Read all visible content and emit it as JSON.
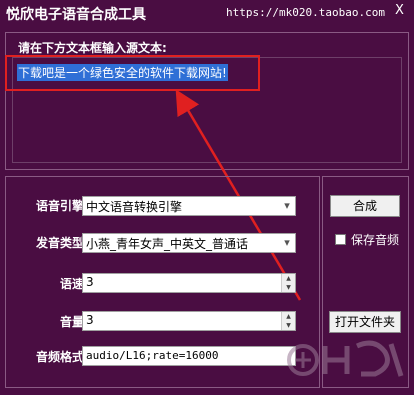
{
  "window": {
    "title": "悦欣电子语音合成工具",
    "url": "https://mk020.taobao.com",
    "close_label": "X"
  },
  "source": {
    "label": "请在下方文本框输入源文本:",
    "text": "下载吧是一个绿色安全的软件下载网站!"
  },
  "settings": {
    "engine_label": "语音引擎",
    "engine_value": "中文语音转换引擎",
    "voice_label": "发音类型",
    "voice_value": "小燕_青年女声_中英文_普通话",
    "rate_label": "语速",
    "rate_value": "3",
    "volume_label": "音量",
    "volume_value": "3",
    "format_label": "音频格式",
    "format_value": "audio/L16;rate=16000"
  },
  "actions": {
    "synthesize_label": "合成",
    "save_audio_label": "保存音频",
    "save_audio_checked": false,
    "open_folder_label": "打开文件夹"
  },
  "colors": {
    "background": "#4a0d42",
    "selection": "#2f6fd6",
    "annotation_red": "#e02020"
  },
  "icons": {
    "close": "close-icon",
    "dropdown": "chevron-down-icon",
    "spin_up": "spin-up-icon",
    "spin_down": "spin-down-icon"
  }
}
